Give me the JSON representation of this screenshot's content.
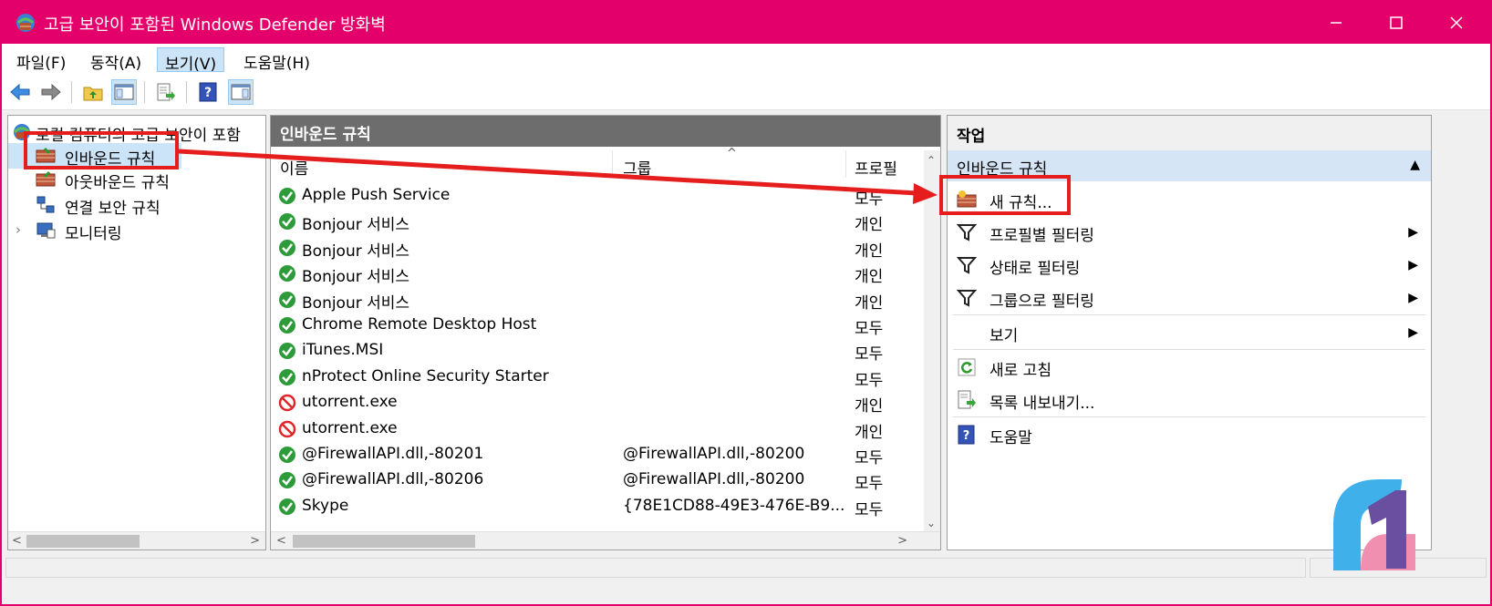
{
  "window": {
    "title": "고급 보안이 포함된 Windows Defender 방화벽",
    "accent_color": "#e3006a",
    "controls": [
      "minimize-icon",
      "maximize-icon",
      "close-icon"
    ]
  },
  "menu": {
    "items": [
      "파일(F)",
      "동작(A)",
      "보기(V)",
      "도움말(H)"
    ],
    "active_index": 2
  },
  "toolbar": {
    "buttons": [
      "back-icon",
      "forward-icon",
      "up-folder-icon",
      "show-hide-tree-icon",
      "export-list-icon",
      "help-icon",
      "show-hide-action-pane-icon"
    ]
  },
  "tree": {
    "root": "로컬 컴퓨터의 고급 보안이 포함",
    "items": [
      "인바운드 규칙",
      "아웃바운드 규칙",
      "연결 보안 규칙",
      "모니터링"
    ],
    "selected_index": 0
  },
  "center": {
    "header": "인바운드 규칙",
    "columns": [
      "이름",
      "그룹",
      "프로필"
    ],
    "rows": [
      {
        "name": "Apple Push Service",
        "group": "",
        "profile": "모두",
        "status": "allow"
      },
      {
        "name": "Bonjour 서비스",
        "group": "",
        "profile": "개인",
        "status": "allow"
      },
      {
        "name": "Bonjour 서비스",
        "group": "",
        "profile": "개인",
        "status": "allow"
      },
      {
        "name": "Bonjour 서비스",
        "group": "",
        "profile": "개인",
        "status": "allow"
      },
      {
        "name": "Bonjour 서비스",
        "group": "",
        "profile": "개인",
        "status": "allow"
      },
      {
        "name": "Chrome Remote Desktop Host",
        "group": "",
        "profile": "모두",
        "status": "allow"
      },
      {
        "name": "iTunes.MSI",
        "group": "",
        "profile": "모두",
        "status": "allow"
      },
      {
        "name": "nProtect Online Security Starter",
        "group": "",
        "profile": "모두",
        "status": "allow"
      },
      {
        "name": "utorrent.exe",
        "group": "",
        "profile": "개인",
        "status": "block"
      },
      {
        "name": "utorrent.exe",
        "group": "",
        "profile": "개인",
        "status": "block"
      },
      {
        "name": "@FirewallAPI.dll,-80201",
        "group": "@FirewallAPI.dll,-80200",
        "profile": "모두",
        "status": "allow"
      },
      {
        "name": "@FirewallAPI.dll,-80206",
        "group": "@FirewallAPI.dll,-80200",
        "profile": "모두",
        "status": "allow"
      },
      {
        "name": "Skype",
        "group": "{78E1CD88-49E3-476E-B9...",
        "profile": "모두",
        "status": "allow"
      }
    ]
  },
  "actions": {
    "title": "작업",
    "section": "인바운드 규칙",
    "items": [
      {
        "label": "새 규칙...",
        "icon": "new-rule-icon",
        "submenu": false
      },
      {
        "label": "프로필별 필터링",
        "icon": "filter-icon",
        "submenu": true
      },
      {
        "label": "상태로 필터링",
        "icon": "filter-icon",
        "submenu": true
      },
      {
        "label": "그룹으로 필터링",
        "icon": "filter-icon",
        "submenu": true
      },
      {
        "label": "보기",
        "icon": "",
        "submenu": true
      },
      {
        "label": "새로 고침",
        "icon": "refresh-icon",
        "submenu": false
      },
      {
        "label": "목록 내보내기...",
        "icon": "export-icon",
        "submenu": false
      },
      {
        "label": "도움말",
        "icon": "help-icon",
        "submenu": false
      }
    ]
  },
  "annotation": {
    "highlight_color": "#e51d1d"
  }
}
